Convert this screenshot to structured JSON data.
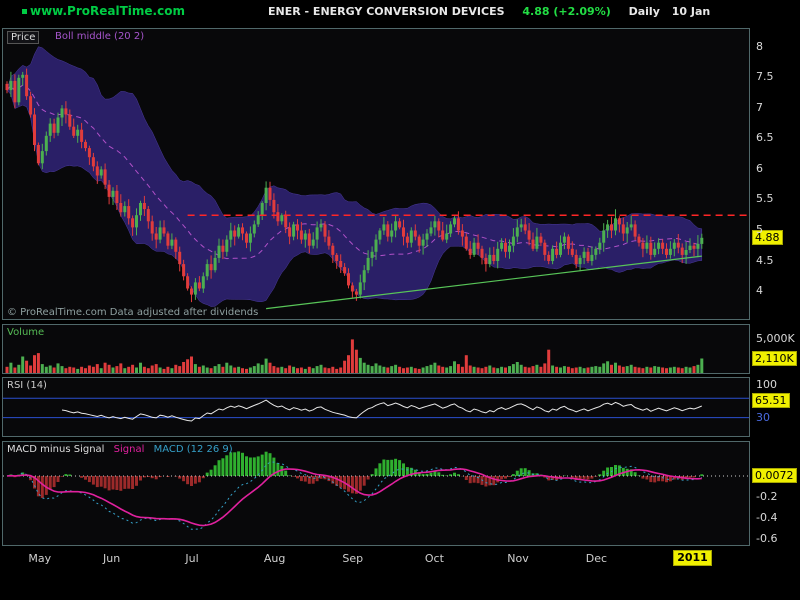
{
  "header": {
    "site": "www.ProRealTime.com",
    "title": "ENER - ENERGY CONVERSION DEVICES",
    "quote": "4.88 (+2.09%)",
    "timeframe": "Daily",
    "date": "10 Jan"
  },
  "price_panel": {
    "label": "Price",
    "boll_label": "Boll middle (20 2)",
    "copyright": "© ProRealTime.com Data adjusted after dividends",
    "last_badge": "4.88"
  },
  "volume_panel": {
    "label": "Volume",
    "axis_top": "5,000K",
    "badge": "2,110K"
  },
  "rsi_panel": {
    "label": "RSI (14)",
    "axis_top": "100",
    "axis_bottom": "30",
    "badge": "65.51"
  },
  "macd_panel": {
    "hist_label": "MACD minus Signal",
    "signal_label": "Signal",
    "macd_label": "MACD (12 26 9)",
    "badge": "0.0072",
    "ticks": [
      -0.2,
      -0.4,
      -0.6
    ]
  },
  "time_axis": {
    "year": "2011"
  },
  "colors": {
    "up": "#4caf50",
    "down": "#e03c3c",
    "bollinger_fill": "#2e2270",
    "bollinger_edge": "#4a3a9a",
    "bollinger_mid": "#b050c8",
    "resistance": "#ff2626",
    "trendline": "#58c558",
    "rsi_line": "#e8e8e8",
    "rsi_levels": "#2a4fd0",
    "macd_signal": "#e0219e",
    "macd_line": "#35a0c8",
    "hist_pos": "#2faf2f",
    "hist_neg": "#9c2a2a",
    "badge_bg": "#f0f000",
    "site_green": "#00cc44",
    "quote_green": "#22dd44"
  },
  "chart_data": {
    "type": "candlestick",
    "title": "ENER - ENERGY CONVERSION DEVICES",
    "timeframe": "Daily",
    "last": {
      "price": 4.88,
      "change_pct": 2.09,
      "volume_k": 2110,
      "rsi": 65.51,
      "macd_minus_signal": 0.0072
    },
    "price_axis_ticks": [
      8,
      7.5,
      7,
      6.5,
      6,
      5.5,
      5,
      4.5,
      4
    ],
    "price_range": [
      3.55,
      8.3
    ],
    "volume_axis_max_k": 7000,
    "bollinger": {
      "period": 20,
      "deviations": 2
    },
    "rsi": {
      "period": 14,
      "upper": 70,
      "lower": 30
    },
    "macd": {
      "fast": 12,
      "slow": 26,
      "signal": 9
    },
    "resistance": {
      "value": 5.25,
      "from_index": 46,
      "style": "dashed"
    },
    "trendline": {
      "from": {
        "index": 66,
        "price": 3.72
      },
      "to": {
        "index": 177,
        "price": 4.58
      }
    },
    "months": [
      {
        "label": "May",
        "index": 8
      },
      {
        "label": "Jun",
        "index": 27
      },
      {
        "label": "Jul",
        "index": 48
      },
      {
        "label": "Aug",
        "index": 68
      },
      {
        "label": "Sep",
        "index": 88
      },
      {
        "label": "Oct",
        "index": 109
      },
      {
        "label": "Nov",
        "index": 130
      },
      {
        "label": "Dec",
        "index": 150
      }
    ],
    "year_index": 172,
    "closes": [
      7.3,
      7.45,
      7.1,
      7.5,
      7.55,
      7.2,
      6.9,
      6.4,
      6.1,
      6.3,
      6.55,
      6.75,
      6.6,
      6.85,
      7.0,
      6.9,
      6.7,
      6.55,
      6.65,
      6.45,
      6.35,
      6.2,
      6.05,
      5.9,
      6.0,
      5.75,
      5.55,
      5.65,
      5.45,
      5.3,
      5.4,
      5.2,
      5.05,
      5.25,
      5.45,
      5.35,
      5.15,
      4.95,
      4.85,
      5.05,
      4.95,
      4.75,
      4.85,
      4.65,
      4.45,
      4.25,
      4.05,
      3.95,
      4.15,
      4.05,
      4.25,
      4.45,
      4.35,
      4.55,
      4.75,
      4.65,
      4.85,
      5.0,
      4.9,
      5.05,
      4.95,
      4.8,
      4.95,
      5.1,
      5.25,
      5.45,
      5.7,
      5.5,
      5.3,
      5.15,
      5.25,
      5.05,
      4.9,
      5.1,
      5.0,
      4.85,
      4.95,
      4.75,
      4.85,
      5.05,
      5.1,
      4.9,
      4.75,
      4.6,
      4.5,
      4.4,
      4.3,
      4.1,
      4.0,
      3.95,
      4.15,
      4.35,
      4.55,
      4.65,
      4.85,
      5.0,
      5.1,
      4.9,
      5.0,
      5.15,
      5.05,
      4.9,
      4.8,
      5.0,
      4.9,
      4.75,
      4.85,
      4.95,
      5.05,
      5.15,
      5.0,
      4.85,
      4.95,
      5.1,
      5.2,
      5.0,
      4.9,
      4.7,
      4.6,
      4.8,
      4.7,
      4.55,
      4.45,
      4.6,
      4.5,
      4.7,
      4.8,
      4.65,
      4.75,
      4.9,
      5.05,
      5.1,
      5.0,
      4.85,
      4.7,
      4.9,
      4.8,
      4.6,
      4.5,
      4.7,
      4.6,
      4.8,
      4.9,
      4.7,
      4.6,
      4.45,
      4.55,
      4.65,
      4.5,
      4.6,
      4.7,
      4.8,
      5.0,
      5.1,
      5.0,
      5.2,
      5.1,
      4.95,
      5.05,
      5.1,
      4.9,
      4.8,
      4.7,
      4.8,
      4.6,
      4.7,
      4.8,
      4.7,
      4.6,
      4.7,
      4.8,
      4.72,
      4.6,
      4.68,
      4.75,
      4.7,
      4.78,
      4.88
    ],
    "volumes_k": [
      900,
      1500,
      800,
      1200,
      2400,
      1800,
      1100,
      2600,
      2900,
      1300,
      900,
      1100,
      800,
      1400,
      1000,
      700,
      900,
      800,
      600,
      900,
      700,
      1100,
      900,
      1300,
      700,
      1500,
      1200,
      800,
      1000,
      1400,
      700,
      900,
      1200,
      800,
      1500,
      900,
      700,
      1100,
      1300,
      800,
      600,
      900,
      700,
      1200,
      1000,
      1600,
      2000,
      2400,
      1300,
      900,
      1100,
      800,
      700,
      1000,
      1300,
      900,
      1500,
      1100,
      800,
      900,
      700,
      600,
      800,
      1000,
      1400,
      1200,
      2100,
      1500,
      1000,
      800,
      900,
      700,
      1100,
      900,
      700,
      800,
      600,
      900,
      700,
      1000,
      1200,
      800,
      700,
      900,
      600,
      800,
      1800,
      2600,
      4900,
      3400,
      2200,
      1500,
      1200,
      1000,
      1400,
      1100,
      900,
      800,
      1000,
      1200,
      900,
      700,
      800,
      900,
      700,
      600,
      800,
      1000,
      1200,
      1500,
      1100,
      900,
      800,
      1000,
      1700,
      1300,
      900,
      2600,
      1100,
      900,
      800,
      700,
      900,
      1100,
      800,
      700,
      900,
      800,
      1000,
      1300,
      1600,
      1200,
      900,
      800,
      1000,
      1200,
      900,
      1400,
      3400,
      1100,
      900,
      800,
      1000,
      900,
      700,
      800,
      900,
      700,
      800,
      900,
      1000,
      900,
      1400,
      1700,
      1200,
      1500,
      1100,
      900,
      1000,
      1200,
      900,
      800,
      700,
      900,
      800,
      1000,
      900,
      800,
      700,
      800,
      900,
      800,
      700,
      900,
      800,
      1000,
      1200,
      2110
    ]
  }
}
